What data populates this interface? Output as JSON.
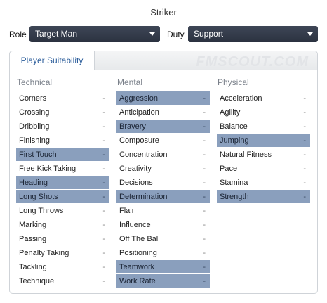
{
  "title": "Striker",
  "role": {
    "label": "Role",
    "value": "Target Man"
  },
  "duty": {
    "label": "Duty",
    "value": "Support"
  },
  "tab": "Player Suitability",
  "watermark": "FMSCOUT.COM",
  "columns": [
    {
      "heading": "Technical",
      "attributes": [
        {
          "name": "Corners",
          "value": "-",
          "highlight": false
        },
        {
          "name": "Crossing",
          "value": "-",
          "highlight": false
        },
        {
          "name": "Dribbling",
          "value": "-",
          "highlight": false
        },
        {
          "name": "Finishing",
          "value": "-",
          "highlight": false
        },
        {
          "name": "First Touch",
          "value": "-",
          "highlight": true
        },
        {
          "name": "Free Kick Taking",
          "value": "-",
          "highlight": false
        },
        {
          "name": "Heading",
          "value": "-",
          "highlight": true
        },
        {
          "name": "Long Shots",
          "value": "-",
          "highlight": true
        },
        {
          "name": "Long Throws",
          "value": "-",
          "highlight": false
        },
        {
          "name": "Marking",
          "value": "-",
          "highlight": false
        },
        {
          "name": "Passing",
          "value": "-",
          "highlight": false
        },
        {
          "name": "Penalty Taking",
          "value": "-",
          "highlight": false
        },
        {
          "name": "Tackling",
          "value": "-",
          "highlight": false
        },
        {
          "name": "Technique",
          "value": "-",
          "highlight": false
        }
      ]
    },
    {
      "heading": "Mental",
      "attributes": [
        {
          "name": "Aggression",
          "value": "-",
          "highlight": true
        },
        {
          "name": "Anticipation",
          "value": "-",
          "highlight": false
        },
        {
          "name": "Bravery",
          "value": "-",
          "highlight": true
        },
        {
          "name": "Composure",
          "value": "-",
          "highlight": false
        },
        {
          "name": "Concentration",
          "value": "-",
          "highlight": false
        },
        {
          "name": "Creativity",
          "value": "-",
          "highlight": false
        },
        {
          "name": "Decisions",
          "value": "-",
          "highlight": false
        },
        {
          "name": "Determination",
          "value": "-",
          "highlight": true
        },
        {
          "name": "Flair",
          "value": "-",
          "highlight": false
        },
        {
          "name": "Influence",
          "value": "-",
          "highlight": false
        },
        {
          "name": "Off The Ball",
          "value": "-",
          "highlight": false
        },
        {
          "name": "Positioning",
          "value": "-",
          "highlight": false
        },
        {
          "name": "Teamwork",
          "value": "-",
          "highlight": true
        },
        {
          "name": "Work Rate",
          "value": "-",
          "highlight": true
        }
      ]
    },
    {
      "heading": "Physical",
      "attributes": [
        {
          "name": "Acceleration",
          "value": "-",
          "highlight": false
        },
        {
          "name": "Agility",
          "value": "-",
          "highlight": false
        },
        {
          "name": "Balance",
          "value": "-",
          "highlight": false
        },
        {
          "name": "Jumping",
          "value": "-",
          "highlight": true
        },
        {
          "name": "Natural Fitness",
          "value": "-",
          "highlight": false
        },
        {
          "name": "Pace",
          "value": "-",
          "highlight": false
        },
        {
          "name": "Stamina",
          "value": "-",
          "highlight": false
        },
        {
          "name": "Strength",
          "value": "-",
          "highlight": true
        }
      ]
    }
  ]
}
